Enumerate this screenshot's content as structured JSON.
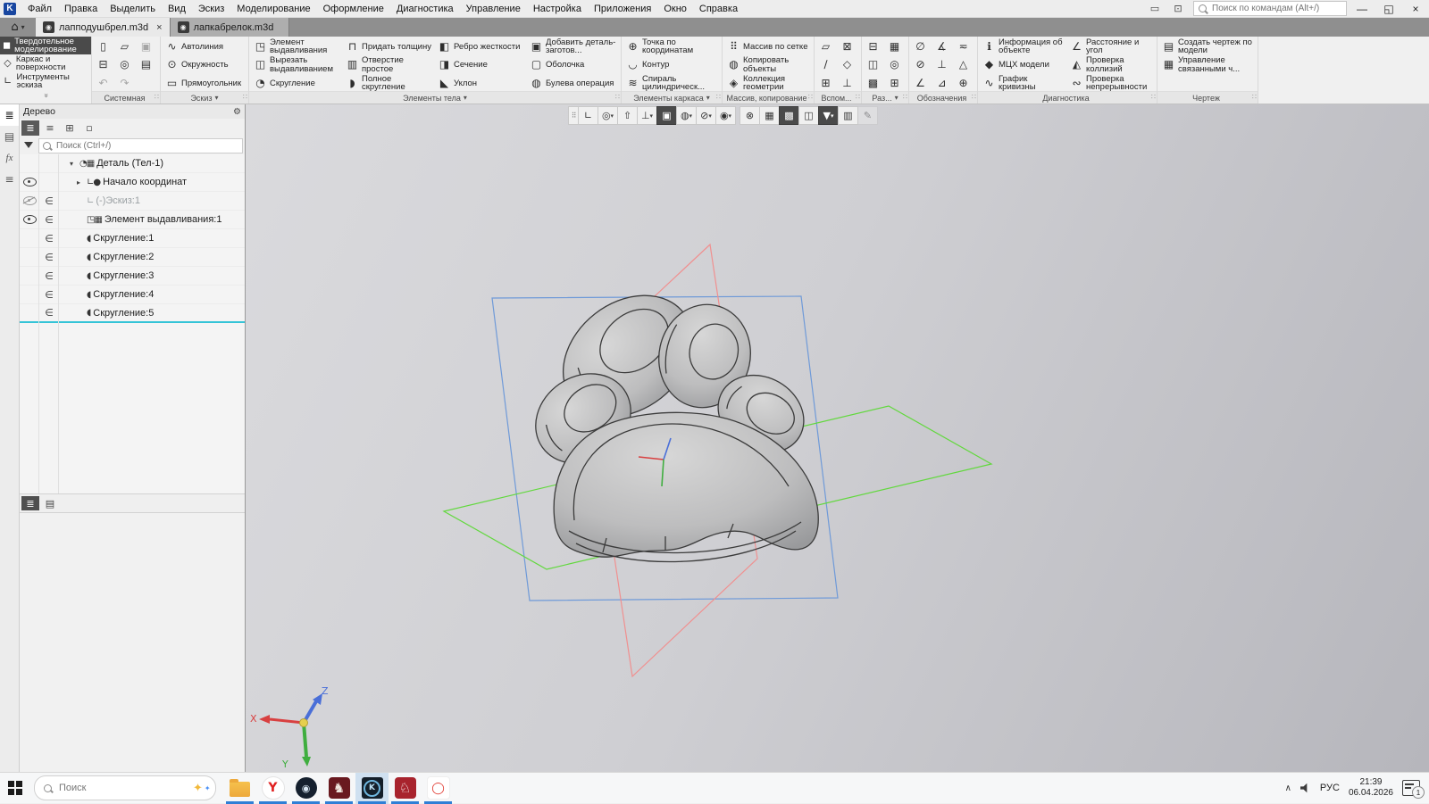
{
  "colors": {
    "selection_accent": "#35c4d7",
    "plane_blue": "#6f9ad8",
    "plane_red": "#f09090",
    "plane_green": "#62d83e",
    "axis_x": "#d84040",
    "axis_y": "#3fae3f",
    "axis_z": "#4a6fd8",
    "taskbar_underline": "#2f7fd6",
    "active_toolbar_bg": "#4a4a4a"
  },
  "window": {
    "app_logo": "K",
    "menus": [
      "Файл",
      "Правка",
      "Выделить",
      "Вид",
      "Эскиз",
      "Моделирование",
      "Оформление",
      "Диагностика",
      "Управление",
      "Настройка",
      "Приложения",
      "Окно",
      "Справка"
    ],
    "command_search_placeholder": "Поиск по командам (Alt+/)",
    "title_icons": [
      {
        "name": "interface-layout-icon",
        "glyph": "▭"
      },
      {
        "name": "screen-mode-icon",
        "glyph": "⊡"
      }
    ],
    "controls": {
      "minimize": "—",
      "restore": "◱",
      "close": "×"
    }
  },
  "tabs": {
    "home_glyph": "⌂",
    "home_caret": "▾",
    "doc_glyph": "◉",
    "items": [
      {
        "name": "tab-lappodushbrel",
        "label": "лапподушбрел.m3d",
        "state": "active",
        "close": "×"
      },
      {
        "name": "tab-lapkabrelok",
        "label": "лапкабрелок.m3d",
        "state": "",
        "close": ""
      }
    ]
  },
  "modes": {
    "collapse_glyph": "»",
    "items": [
      {
        "name": "mode-solid-modeling",
        "glyph": "◼",
        "label": "Твердотельное моделирование",
        "state": "active"
      },
      {
        "name": "mode-wireframe-surfaces",
        "glyph": "◇",
        "label": "Каркас и поверхности",
        "state": ""
      },
      {
        "name": "mode-sketch-tools",
        "glyph": "∟",
        "label": "Инструменты эскиза",
        "state": ""
      }
    ]
  },
  "ribbon": {
    "groups": [
      {
        "label": "Системная",
        "caret": "",
        "handle": "∷",
        "items": [
          {
            "name": "new-document-button",
            "glyph": "▯"
          },
          {
            "name": "print-button",
            "glyph": "⊟"
          },
          {
            "name": "undo-button",
            "glyph": "↶",
            "state": "grayed"
          },
          {
            "name": "open-document-button",
            "glyph": "▱"
          },
          {
            "name": "print-preview-button",
            "glyph": "◎"
          },
          {
            "name": "redo-button",
            "glyph": "↷",
            "state": "grayed"
          },
          {
            "name": "save-button",
            "glyph": "▣",
            "state": "grayed"
          },
          {
            "name": "save-as-button",
            "glyph": "▤"
          }
        ]
      },
      {
        "label": "Эскиз",
        "caret": "▾",
        "handle": "∷",
        "items": [
          {
            "name": "autoline-button",
            "glyph": "∿",
            "label": "Автолиния"
          },
          {
            "name": "circle-button",
            "glyph": "⊙",
            "label": "Окружность"
          },
          {
            "name": "rectangle-button",
            "glyph": "▭",
            "label": "Прямоугольник"
          }
        ]
      },
      {
        "label": "Элементы тела",
        "caret": "▾",
        "handle": "∷",
        "items": [
          {
            "name": "extrude-button",
            "glyph": "◳",
            "label": "Элемент выдавливания"
          },
          {
            "name": "cut-extrude-button",
            "glyph": "◫",
            "label": "Вырезать выдавливанием"
          },
          {
            "name": "fillet-button",
            "glyph": "◔",
            "label": "Скругление"
          },
          {
            "name": "thicken-button",
            "glyph": "⊓",
            "label": "Придать толщину"
          },
          {
            "name": "simple-hole-button",
            "glyph": "▥",
            "label": "Отверстие простое"
          },
          {
            "name": "full-fillet-button",
            "glyph": "◗",
            "label": "Полное скругление"
          },
          {
            "name": "rib-button",
            "glyph": "◧",
            "label": "Ребро жесткости"
          },
          {
            "name": "section-button",
            "glyph": "◨",
            "label": "Сечение"
          },
          {
            "name": "draft-button",
            "glyph": "◣",
            "label": "Уклон"
          },
          {
            "name": "add-part-blank-button",
            "glyph": "▣",
            "label": "Добавить деталь-заготов..."
          },
          {
            "name": "shell-button",
            "glyph": "▢",
            "label": "Оболочка"
          },
          {
            "name": "boolean-button",
            "glyph": "◍",
            "label": "Булева операция"
          }
        ]
      },
      {
        "label": "Элементы каркаса",
        "caret": "▾",
        "handle": "∷",
        "items": [
          {
            "name": "point-by-coordinates-button",
            "glyph": "⊕",
            "label": "Точка по координатам"
          },
          {
            "name": "contour-button",
            "glyph": "◡",
            "label": "Контур"
          },
          {
            "name": "cylindrical-spiral-button",
            "glyph": "≋",
            "label": "Спираль цилиндрическ..."
          }
        ]
      },
      {
        "label": "Массив, копирование",
        "caret": "",
        "handle": "∷",
        "items": [
          {
            "name": "grid-array-button",
            "glyph": "⠿",
            "label": "Массив по сетке"
          },
          {
            "name": "copy-objects-button",
            "glyph": "◍",
            "label": "Копировать объекты"
          },
          {
            "name": "geometry-collection-button",
            "glyph": "◈",
            "label": "Коллекция геометрии"
          }
        ]
      },
      {
        "label": "Вспом...",
        "caret": "",
        "handle": "∷",
        "items": [
          {
            "name": "datum-plane-button",
            "glyph": "▱"
          },
          {
            "name": "datum-axis-button",
            "glyph": "∕"
          },
          {
            "name": "datum-point-button",
            "glyph": "⊞"
          },
          {
            "name": "local-cs-button",
            "glyph": "⊠"
          },
          {
            "name": "control-point-button",
            "glyph": "◇"
          },
          {
            "name": "perpendicular-plane-button",
            "glyph": "⊥"
          }
        ]
      },
      {
        "label": "Раз...",
        "caret": "▾",
        "handle": "∷",
        "items": [
          {
            "name": "raz-tool-button-1",
            "glyph": "⊟"
          },
          {
            "name": "raz-tool-button-2",
            "glyph": "◫"
          },
          {
            "name": "raz-tool-button-3",
            "glyph": "▩"
          },
          {
            "name": "raz-tool-button-4",
            "glyph": "▦"
          },
          {
            "name": "raz-tool-button-5",
            "glyph": "◎"
          },
          {
            "name": "raz-tool-button-6",
            "glyph": "⊞"
          }
        ]
      },
      {
        "label": "Обозначения",
        "caret": "",
        "handle": "∷",
        "items": [
          {
            "name": "designation-tool-button-1",
            "glyph": "∅"
          },
          {
            "name": "designation-tool-button-2",
            "glyph": "⊘"
          },
          {
            "name": "designation-tool-button-3",
            "glyph": "∠"
          },
          {
            "name": "designation-tool-button-4",
            "glyph": "∡"
          },
          {
            "name": "designation-tool-button-5",
            "glyph": "⊥"
          },
          {
            "name": "designation-tool-button-6",
            "glyph": "⊿"
          },
          {
            "name": "designation-tool-button-7",
            "glyph": "≂"
          },
          {
            "name": "designation-tool-button-8",
            "glyph": "△"
          },
          {
            "name": "designation-tool-button-9",
            "glyph": "⊕"
          }
        ]
      },
      {
        "label": "Диагностика",
        "caret": "",
        "handle": "∷",
        "items": [
          {
            "name": "object-info-button",
            "glyph": "ℹ",
            "label": "Информация об объекте"
          },
          {
            "name": "mass-properties-button",
            "glyph": "◆",
            "label": "МЦХ модели"
          },
          {
            "name": "curvature-graph-button",
            "glyph": "∿",
            "label": "График кривизны"
          },
          {
            "name": "distance-angle-button",
            "glyph": "∠",
            "label": "Расстояние и угол"
          },
          {
            "name": "collision-check-button",
            "glyph": "◭",
            "label": "Проверка коллизий"
          },
          {
            "name": "continuity-check-button",
            "glyph": "∾",
            "label": "Проверка непрерывности"
          }
        ]
      },
      {
        "label": "Чертеж",
        "caret": "",
        "handle": "∷",
        "items": [
          {
            "name": "create-drawing-button",
            "glyph": "▤",
            "label": "Создать чертеж по модели"
          },
          {
            "name": "linked-documents-button",
            "glyph": "▦",
            "label": "Управление связанными ч..."
          }
        ]
      }
    ]
  },
  "sidebar": {
    "items": [
      {
        "name": "panel-tree-button",
        "glyph": "≣",
        "state": "active"
      },
      {
        "name": "panel-parameters-button",
        "glyph": "▤",
        "state": ""
      },
      {
        "name": "panel-variables-button",
        "glyph": "fx",
        "state": "fxfont"
      },
      {
        "name": "panel-menu-button",
        "glyph": "≡",
        "state": ""
      }
    ]
  },
  "panel": {
    "title": "Дерево",
    "gear_glyph": "⚙",
    "toolbar": [
      {
        "name": "tree-view-mode-button",
        "glyph": "≣",
        "state": "active"
      },
      {
        "name": "tree-composition-button",
        "glyph": "≡",
        "state": ""
      },
      {
        "name": "tree-relations-button",
        "glyph": "⊞",
        "state": ""
      },
      {
        "name": "tree-area-select-button",
        "glyph": "▫",
        "state": ""
      }
    ],
    "search_placeholder": "Поиск (Ctrl+/)",
    "tree": [
      {
        "name": "tree-item-detail",
        "lvl": "lvl-1",
        "arrow": "▾",
        "eye": "",
        "sub": "",
        "icon": "◔▦",
        "label": "Деталь (Тел-1)",
        "state": ""
      },
      {
        "name": "tree-item-origin",
        "lvl": "lvl-2",
        "arrow": "▸",
        "eye": "eye-on",
        "sub": "",
        "icon": "∟●",
        "label": "Начало координат",
        "state": ""
      },
      {
        "name": "tree-item-sketch-1",
        "lvl": "lvl-2",
        "arrow": "",
        "eye": "eye-off",
        "sub": "∈",
        "icon": "∟",
        "label": "(-)Эскиз:1",
        "state": "grayed"
      },
      {
        "name": "tree-item-extrude-1",
        "lvl": "lvl-2",
        "arrow": "",
        "eye": "eye-on",
        "sub": "∈",
        "icon": "◳▦",
        "label": "Элемент выдавливания:1",
        "state": ""
      },
      {
        "name": "tree-item-fillet-1",
        "lvl": "lvl-2",
        "arrow": "",
        "eye": "",
        "sub": "∈",
        "icon": "◖",
        "label": "Скругление:1",
        "state": ""
      },
      {
        "name": "tree-item-fillet-2",
        "lvl": "lvl-2",
        "arrow": "",
        "eye": "",
        "sub": "∈",
        "icon": "◖",
        "label": "Скругление:2",
        "state": ""
      },
      {
        "name": "tree-item-fillet-3",
        "lvl": "lvl-2",
        "arrow": "",
        "eye": "",
        "sub": "∈",
        "icon": "◖",
        "label": "Скругление:3",
        "state": ""
      },
      {
        "name": "tree-item-fillet-4",
        "lvl": "lvl-2",
        "arrow": "",
        "eye": "",
        "sub": "∈",
        "icon": "◖",
        "label": "Скругление:4",
        "state": ""
      },
      {
        "name": "tree-item-fillet-5",
        "lvl": "lvl-2",
        "arrow": "",
        "eye": "",
        "sub": "∈",
        "icon": "◖",
        "label": "Скругление:5",
        "state": "selected"
      }
    ],
    "bottom_tabs": [
      {
        "name": "panel-tab-tree",
        "glyph": "≣",
        "state": "active"
      },
      {
        "name": "panel-tab-composition",
        "glyph": "▤",
        "state": ""
      }
    ]
  },
  "viewport": {
    "toolbar": [
      {
        "name": "viewport-toolbar-handle",
        "glyph": "⠿",
        "cls": "vt-handle"
      },
      {
        "name": "sketch-mode-button",
        "glyph": "∟"
      },
      {
        "name": "zoom-button",
        "glyph": "◎",
        "caret": "▾"
      },
      {
        "name": "orientation-button",
        "glyph": "⇧"
      },
      {
        "name": "coordinate-systems-button",
        "glyph": "⊥",
        "caret": "▾"
      },
      {
        "name": "shaded-view-button",
        "glyph": "▣",
        "state": "active"
      },
      {
        "name": "display-style-button",
        "glyph": "◍",
        "caret": "▾"
      },
      {
        "name": "hide-objects-button",
        "glyph": "⊘",
        "caret": "▾"
      },
      {
        "name": "snapshot-button",
        "glyph": "◉",
        "caret": "▾"
      },
      {
        "name": "toolbar-divider",
        "glyph": "",
        "cls": "vt-div"
      },
      {
        "name": "section-display-button",
        "glyph": "⊗"
      },
      {
        "name": "clipping-button",
        "glyph": "▦"
      },
      {
        "name": "exploded-view-button",
        "glyph": "▩",
        "state": "active"
      },
      {
        "name": "scene-settings-button",
        "glyph": "◫"
      },
      {
        "name": "filter-button",
        "glyph": "▼",
        "state": "active",
        "caret": "▾"
      },
      {
        "name": "model-structure-button",
        "glyph": "▥"
      },
      {
        "name": "quick-sketch-button",
        "glyph": "✎",
        "state": "grayed"
      }
    ],
    "triad_labels": {
      "x": "X",
      "y": "Y",
      "z": "Z"
    }
  },
  "taskbar": {
    "search_placeholder": "Поиск",
    "sparkle_big": "✦",
    "sparkle_small": "✦",
    "apps": [
      {
        "name": "taskbar-explorer",
        "cls": "ico-folder",
        "glyph": ""
      },
      {
        "name": "taskbar-yandex-browser",
        "cls": "ico-yandex",
        "glyph": "Y"
      },
      {
        "name": "taskbar-steam",
        "cls": "ico-steam",
        "glyph": "◉"
      },
      {
        "name": "taskbar-horse-app",
        "cls": "ico-horse",
        "glyph": "♞"
      },
      {
        "name": "taskbar-kompas-3d",
        "cls": "ico-kompas",
        "glyph": "K",
        "state": "active"
      },
      {
        "name": "taskbar-bird-app",
        "cls": "ico-bird",
        "glyph": "♘"
      },
      {
        "name": "taskbar-opera",
        "cls": "ico-opera",
        "glyph": "◯"
      }
    ],
    "tray": {
      "chevron": "∧",
      "lang": "РУС",
      "time": "21:39",
      "date": "06.04.2026",
      "badge": "1"
    }
  }
}
